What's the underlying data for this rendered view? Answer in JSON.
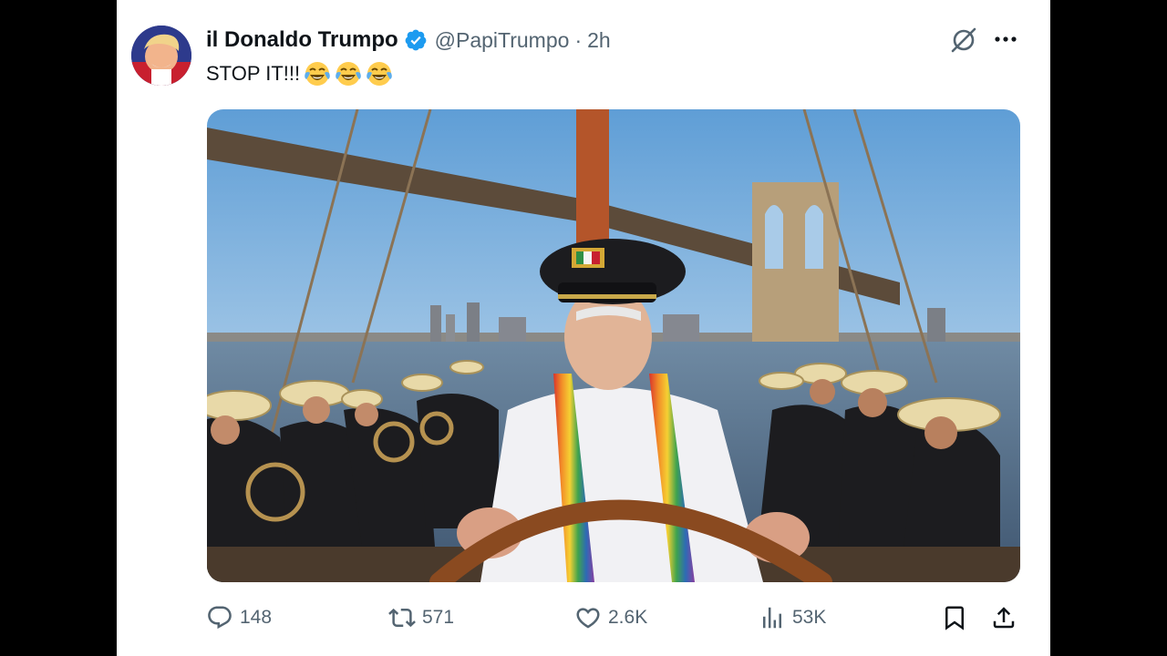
{
  "post": {
    "author": {
      "display_name": "il Donaldo Trumpo",
      "handle": "@PapiTrumpo",
      "verified": true,
      "avatar_icon": "user-avatar"
    },
    "separator": "·",
    "time": "2h",
    "text": "STOP IT!!!",
    "emojis": [
      "face-with-tears-of-joy",
      "face-with-tears-of-joy",
      "face-with-tears-of-joy"
    ],
    "media": {
      "type": "image",
      "alt_text": ""
    },
    "stats": {
      "replies": "148",
      "reposts": "571",
      "likes": "2.6K",
      "views": "53K"
    }
  },
  "icons": {
    "grok": "grok-icon",
    "more": "more-icon",
    "reply": "reply-icon",
    "repost": "repost-icon",
    "like": "heart-icon",
    "views": "views-icon",
    "bookmark": "bookmark-icon",
    "share": "share-icon"
  },
  "colors": {
    "verified_blue": "#1d9bf0",
    "text_primary": "#0f1419",
    "text_secondary": "#536471",
    "frame": "#000000",
    "card_bg": "#ffffff"
  }
}
